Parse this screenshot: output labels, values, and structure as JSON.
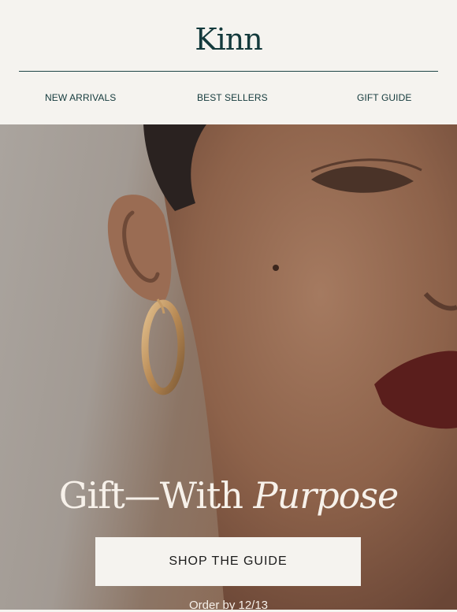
{
  "brand": {
    "logo_text": "Kinn"
  },
  "nav": [
    {
      "label": "NEW ARRIVALS"
    },
    {
      "label": "BEST SELLERS"
    },
    {
      "label": "GIFT GUIDE"
    }
  ],
  "hero": {
    "headline_main": "Gift—With ",
    "headline_italic": "Purpose",
    "cta_label": "SHOP THE GUIDE",
    "order_note": "Order by 12/13"
  },
  "colors": {
    "brand_teal": "#143a3c",
    "page_bg": "#f5f3ef",
    "hero_text": "#f7f1ea"
  }
}
